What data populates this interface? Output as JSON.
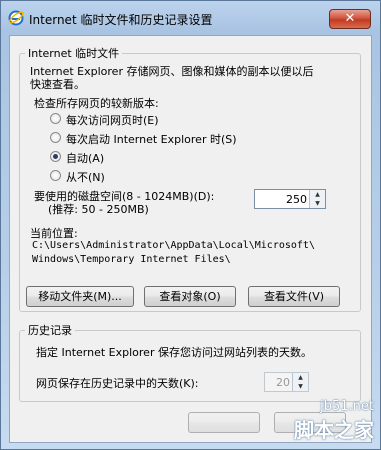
{
  "window": {
    "title": "Internet 临时文件和历史记录设置",
    "close_label": "✕"
  },
  "temp_files": {
    "group_title": "Internet 临时文件",
    "description_line1": "Internet Explorer 存储网页、图像和媒体的副本以便以后",
    "description_line2": "快速查看。",
    "check_label": "检查所存网页的较新版本:",
    "options": [
      {
        "label": "每次访问网页时(E)",
        "checked": false
      },
      {
        "label": "每次启动 Internet Explorer 时(S)",
        "checked": false
      },
      {
        "label": "自动(A)",
        "checked": true
      },
      {
        "label": "从不(N)",
        "checked": false
      }
    ],
    "disk_space_label": "要使用的磁盘空间(8 - 1024MB)(D):",
    "disk_space_hint": "(推荐: 50 - 250MB)",
    "disk_space_value": "250",
    "location_label": "当前位置:",
    "location_line1": "C:\\Users\\Administrator\\AppData\\Local\\Microsoft\\",
    "location_line2": "Windows\\Temporary Internet Files\\",
    "buttons": {
      "move_folder": "移动文件夹(M)...",
      "view_objects": "查看对象(O)",
      "view_files": "查看文件(V)"
    }
  },
  "history": {
    "group_title": "历史记录",
    "description": "指定 Internet Explorer 保存您访问过网站列表的天数。",
    "days_label": "网页保存在历史记录中的天数(K):",
    "days_value": "20"
  },
  "watermark": {
    "line1": "jb51.net",
    "line2": "脚本之家"
  }
}
